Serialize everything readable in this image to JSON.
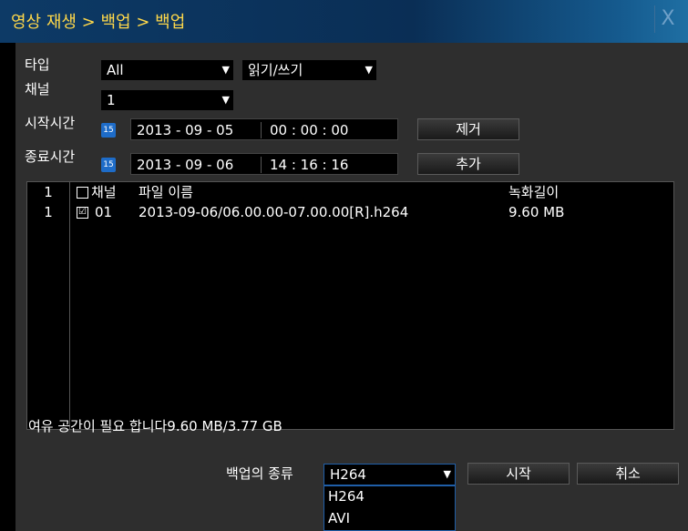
{
  "window": {
    "title": "영상 재생 > 백업 > 백업",
    "close_label": "X"
  },
  "form": {
    "type_label": "타입",
    "type_value": "All",
    "rw_value": "읽기/쓰기",
    "channel_label": "채널",
    "channel_value": "1",
    "start_label": "시작시간",
    "start_date": "2013 - 09 - 05",
    "start_time": "00 : 00 : 00",
    "end_label": "종료시간",
    "end_date": "2013 - 09 - 06",
    "end_time": "14 : 16 : 16",
    "calendar_glyph": "15",
    "remove_button": "제거",
    "add_button": "추가"
  },
  "list": {
    "header": {
      "index": "1",
      "channel": "채널",
      "filename": "파일 이름",
      "size": "녹화길이"
    },
    "rows": [
      {
        "index": "1",
        "checked": "☑",
        "channel": "01",
        "filename": "2013-09-06/06.00.00-07.00.00[R].h264",
        "size": "9.60 MB"
      }
    ]
  },
  "status": "여유 공간이 필요 합니다9.60 MB/3.77 GB",
  "backup": {
    "type_label": "백업의 종류",
    "type_value": "H264",
    "options": [
      "H264",
      "AVI"
    ],
    "start_button": "시작",
    "cancel_button": "취소"
  },
  "colors": {
    "title_text": "#ffd84a",
    "panel_bg": "#2e2e2e",
    "accent_blue": "#1e6cc8"
  }
}
